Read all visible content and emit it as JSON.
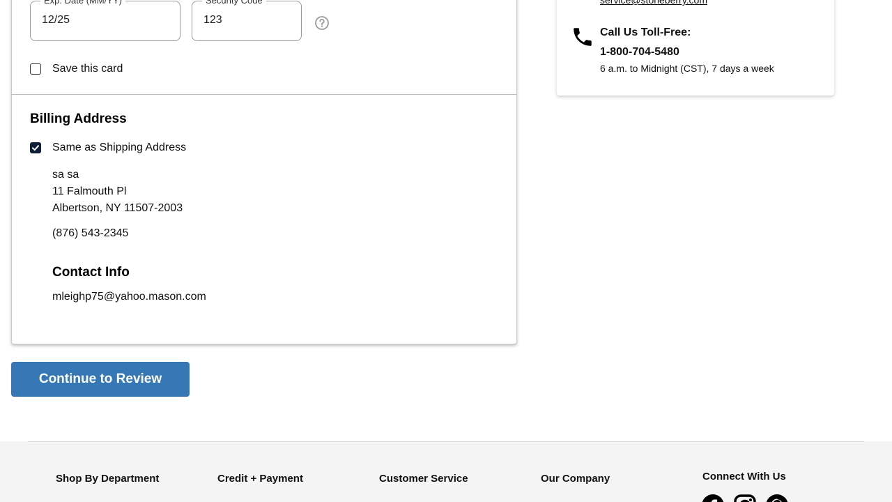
{
  "payment": {
    "exp_date": {
      "label": "Exp. Date (MM/YY)",
      "value": "12/25"
    },
    "security_code": {
      "label": "Security Code",
      "value": "123"
    },
    "save_card": {
      "label": "Save this card",
      "checked": false
    }
  },
  "billing": {
    "title": "Billing Address",
    "same_as_shipping": {
      "label": "Same as Shipping Address",
      "checked": true
    },
    "address": {
      "name": "sa sa",
      "street": "11 Falmouth Pl",
      "city_state_zip": "Albertson, NY 11507-2003",
      "phone": "(876) 543-2345"
    },
    "contact": {
      "title": "Contact Info",
      "email": "mleighp75@yahoo.mason.com"
    }
  },
  "actions": {
    "continue_label": "Continue to Review"
  },
  "help": {
    "email": "service@stoneberry.com",
    "call_title": "Call Us Toll-Free:",
    "call_number": "1-800-704-5480",
    "call_hours": "6 a.m. to Midnight (CST), 7 days a week"
  },
  "footer": {
    "columns": [
      "Shop By Department",
      "Credit + Payment",
      "Customer Service",
      "Our Company"
    ],
    "connect_title": "Connect With Us",
    "social_icons": [
      "facebook-icon",
      "instagram-icon",
      "pinterest-icon"
    ]
  },
  "colors": {
    "primary_button": "#3578b5",
    "checkbox_checked": "#0f1f3a",
    "footer_bg": "#f4f4f4"
  }
}
